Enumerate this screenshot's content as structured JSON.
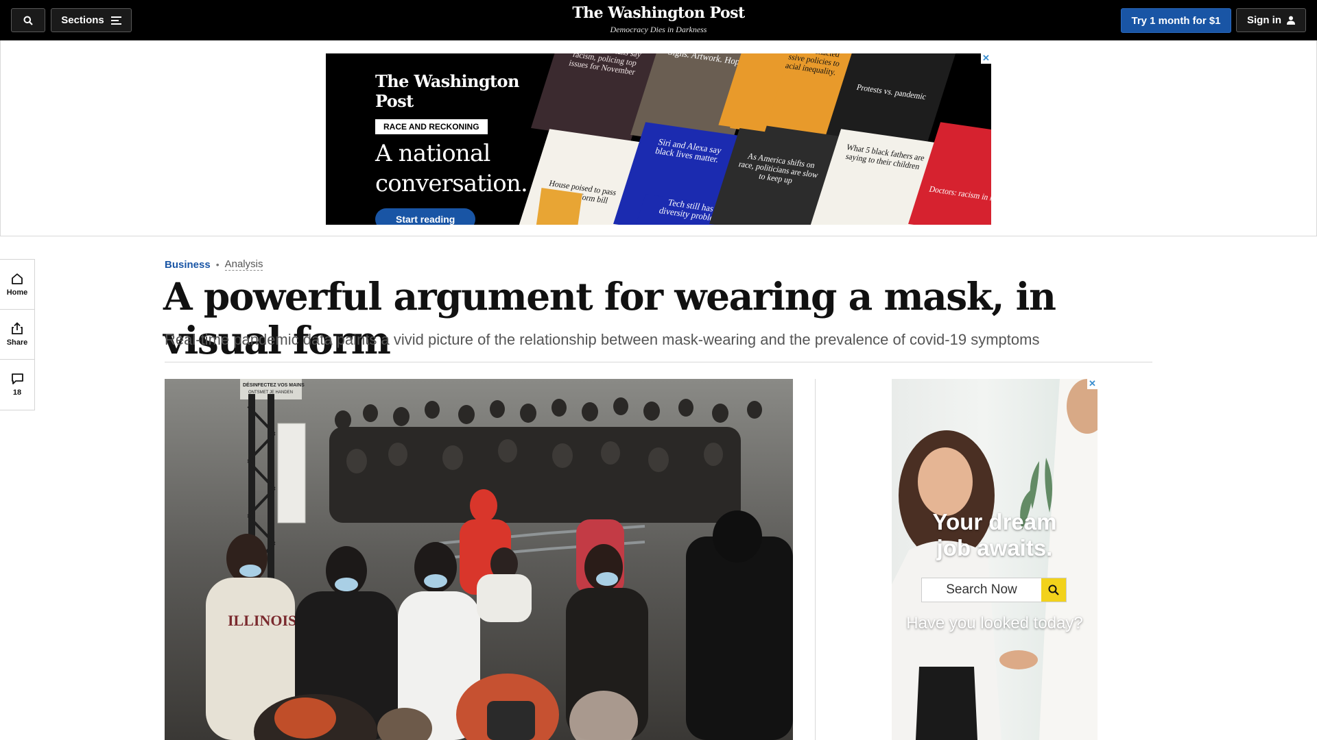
{
  "nav": {
    "sections_label": "Sections",
    "logo": "The Washington Post",
    "tagline": "Democracy Dies in Darkness",
    "subscribe_label": "Try 1 month for $1",
    "signin_label": "Sign in"
  },
  "banner_ad": {
    "logo": "The Washington Post",
    "badge": "RACE AND RECKONING",
    "headline_line1": "A national",
    "headline_line2": "conversation.",
    "cta": "Start reading",
    "tiles": [
      "Black Americans say racism, policing top issues for November",
      "Signs. Artwork. Hope.",
      "Minneapolis enacted progressive policies to fight racial inequality.",
      "Protests vs. pandemic",
      "House poised to pass police reform bill",
      "Siri and Alexa say black lives matter.",
      "Tech still has a diversity problem.",
      "As America shifts on race, politicians are slow to keep up",
      "What 5 black fathers are saying to their children",
      "Doctors: racism in health"
    ],
    "close": "✕"
  },
  "rail": {
    "home_label": "Home",
    "share_label": "Share",
    "comments_count": "18"
  },
  "article": {
    "section": "Business",
    "separator": "•",
    "label": "Analysis",
    "title": "A powerful argument for wearing a mask, in visual form",
    "subtitle": "Real-time pandemic data paints a vivid picture of the relationship between mask-wearing and the prevalence of covid-19 symptoms",
    "photo_sign": "DÉSINFECTEZ VOS MAINS",
    "photo_sign2": "ONTSMET JE HANDEN",
    "photo_sweatshirt": "ILLINOIS"
  },
  "side_ad": {
    "headline_line1": "Your dream",
    "headline_line2": "job awaits.",
    "search_label": "Search Now",
    "sub": "Have you looked today?",
    "close": "✕"
  },
  "colors": {
    "brand_blue": "#1955a5",
    "nav_bg": "#000000"
  },
  "icons": [
    "search-icon",
    "hamburger-icon",
    "user-icon",
    "home-icon",
    "share-icon",
    "comment-icon",
    "magnifier-icon"
  ]
}
